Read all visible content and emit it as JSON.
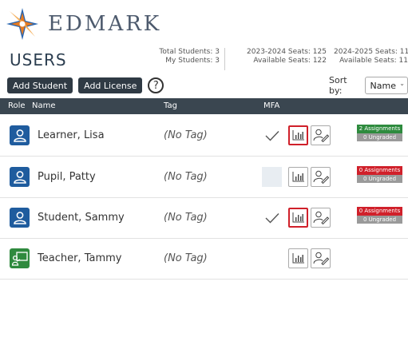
{
  "brand": {
    "name": "EDMARK"
  },
  "header": {
    "title": "USERS",
    "total_students": "Total Students: 3",
    "my_students": "My Students: 3",
    "seats_2023": "2023-2024 Seats: 125",
    "available_2023": "Available Seats: 122",
    "seats_2024": "2024-2025 Seats: 11",
    "available_2024": "Available Seats: 11"
  },
  "toolbar": {
    "add_student": "Add Student",
    "add_license": "Add License",
    "help": "?",
    "sort_label": "Sort by:",
    "sort_value": "Name"
  },
  "columns": {
    "role": "Role",
    "name": "Name",
    "tag": "Tag",
    "mfa": "MFA"
  },
  "rows": [
    {
      "name": "Learner, Lisa",
      "tag": "(No Tag)",
      "role": "student",
      "mfa": true,
      "assignments": "2 Assignments",
      "ungraded": "0 Ungraded",
      "assign_color": "#2e8b3e"
    },
    {
      "name": "Pupil, Patty",
      "tag": "(No Tag)",
      "role": "student",
      "mfa": false,
      "assignments": "0 Assignments",
      "ungraded": "0 Ungraded",
      "assign_color": "#d0202a"
    },
    {
      "name": "Student, Sammy",
      "tag": "(No Tag)",
      "role": "student",
      "mfa": true,
      "assignments": "0 Assignments",
      "ungraded": "0 Ungraded",
      "assign_color": "#d0202a"
    },
    {
      "name": "Teacher, Tammy",
      "tag": "(No Tag)",
      "role": "teacher"
    }
  ],
  "colors": {
    "header_bg": "#3a4650",
    "student_avatar": "#1f5c9e",
    "teacher_avatar": "#2f8a3e",
    "highlight": "#d0202a"
  },
  "icons": {
    "logo": "edmark-star-logo",
    "student": "student-person-icon",
    "teacher": "teacher-board-icon",
    "mfa": "checkmark-icon",
    "report": "bar-chart-icon",
    "edit": "edit-user-icon"
  }
}
